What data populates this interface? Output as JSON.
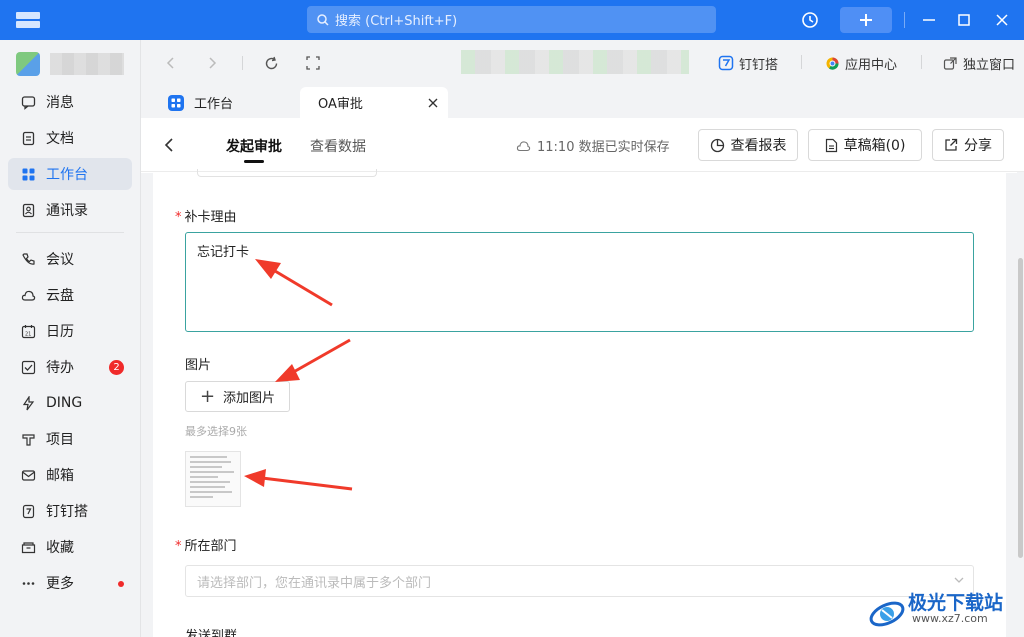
{
  "titlebar": {
    "search_placeholder": "搜索 (Ctrl+Shift+F)"
  },
  "sidebar": {
    "items": [
      {
        "label": "消息",
        "icon": "message-icon"
      },
      {
        "label": "文档",
        "icon": "document-icon"
      },
      {
        "label": "工作台",
        "icon": "workbench-icon",
        "active": true
      },
      {
        "label": "通讯录",
        "icon": "contacts-icon"
      },
      {
        "label": "会议",
        "icon": "meeting-icon"
      },
      {
        "label": "云盘",
        "icon": "cloud-icon"
      },
      {
        "label": "日历",
        "icon": "calendar-icon"
      },
      {
        "label": "待办",
        "icon": "todo-icon",
        "badge": "2"
      },
      {
        "label": "DING",
        "icon": "ding-icon"
      },
      {
        "label": "项目",
        "icon": "project-icon"
      },
      {
        "label": "邮箱",
        "icon": "mail-icon"
      },
      {
        "label": "钉钉搭",
        "icon": "dingda-icon"
      },
      {
        "label": "收藏",
        "icon": "favorites-icon"
      },
      {
        "label": "更多",
        "icon": "more-icon",
        "dot": true
      }
    ]
  },
  "browserbar": {
    "links": [
      "钉钉搭",
      "应用中心",
      "独立窗口"
    ]
  },
  "tabs": [
    {
      "label": "工作台"
    },
    {
      "label": "OA审批",
      "active": true
    }
  ],
  "header": {
    "tabs": [
      "发起审批",
      "查看数据"
    ],
    "saved_status": "11:10 数据已实时保存",
    "buttons": [
      "查看报表",
      "草稿箱(0)",
      "分享"
    ]
  },
  "form": {
    "reason_label": "补卡理由",
    "reason_value": "忘记打卡",
    "image_label": "图片",
    "add_image_label": "添加图片",
    "image_hint": "最多选择9张",
    "dept_label": "所在部门",
    "dept_placeholder": "请选择部门，您在通讯录中属于多个部门",
    "next_label": "发送到群"
  },
  "watermark": {
    "text": "极光下载站",
    "url": "www.xz7.com"
  },
  "colors": {
    "brand": "#1f74f0",
    "textarea_border": "#3aa3a0",
    "required": "#f02a2a",
    "annotation_arrow": "#f03a2a"
  }
}
